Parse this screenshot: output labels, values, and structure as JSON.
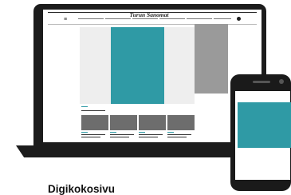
{
  "caption": "Digikokosivu",
  "website": {
    "masthead": "Turun Sanomat",
    "menu_icon_glyph": "≡",
    "nav_item_count": 6
  },
  "colors": {
    "device": "#1c1c1c",
    "accent_teal": "#2f9aa5",
    "placeholder_light": "#eeeeee",
    "placeholder_mid": "#9a9a9a",
    "placeholder_dark": "#6d6d6d"
  },
  "icons": [
    "hamburger-menu-icon",
    "user-icon"
  ]
}
